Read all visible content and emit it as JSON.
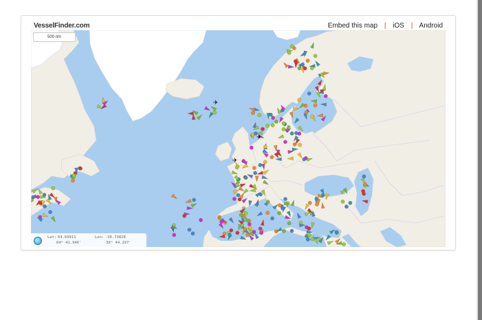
{
  "header": {
    "logo": "VesselFinder.com",
    "links": [
      "Embed this map",
      "iOS",
      "Android"
    ],
    "separator": "|"
  },
  "map": {
    "scale_label": "500 nm",
    "coords": {
      "lat_label": "Lat:",
      "lat_decimal": "64.69911",
      "lat_dms": "64° 41.946'",
      "lon_label": "Lon:",
      "lon_decimal": "-36.73828",
      "lon_dms": "-36° 44.297'"
    }
  },
  "colors": {
    "sea": "#a9cdee",
    "land": "#f1eee6",
    "ice": "#ffffff",
    "vessel_palette": [
      "#9acd32",
      "#4a86c8",
      "#f0c020",
      "#cc33cc",
      "#e03030",
      "#f08a20",
      "#77bb33",
      "#3399aa"
    ]
  }
}
